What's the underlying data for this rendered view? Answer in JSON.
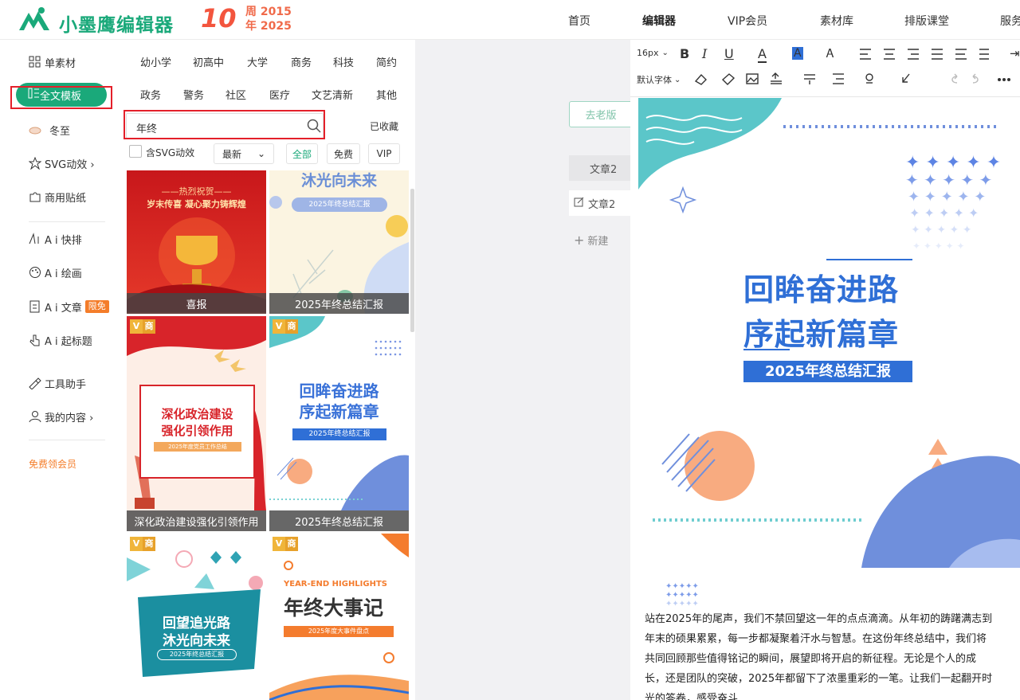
{
  "brand": {
    "name": "小墨鹰编辑器",
    "anniv_number": "10",
    "anniv_line1": "周 2015",
    "anniv_line2": "年 2025"
  },
  "nav": [
    "首页",
    "编辑器",
    "VIP会员",
    "素材库",
    "排版课堂",
    "服务"
  ],
  "sidebar": {
    "items": [
      {
        "label": "单素材",
        "icon": "grid-icon"
      },
      {
        "label": "全文模板",
        "icon": "template-icon"
      },
      {
        "label": "冬至",
        "icon": "dumpling-icon"
      },
      {
        "label": "SVG动效 ›",
        "icon": "star-icon"
      },
      {
        "label": "商用贴纸",
        "icon": "puzzle-icon"
      },
      {
        "label": "A i 快排",
        "icon": "ai-icon"
      },
      {
        "label": "A i 绘画",
        "icon": "palette-icon"
      },
      {
        "label": "A i 文章",
        "icon": "doc-icon",
        "badge": "限免"
      },
      {
        "label": "A i 起标题",
        "icon": "pointer-icon"
      },
      {
        "label": "工具助手",
        "icon": "tools-icon"
      },
      {
        "label": "我的内容 ›",
        "icon": "user-icon"
      }
    ],
    "promo": "免费领会员"
  },
  "panel": {
    "categories_row1": [
      "幼小学",
      "初高中",
      "大学",
      "商务",
      "科技",
      "简约"
    ],
    "categories_row2": [
      "政务",
      "警务",
      "社区",
      "医疗",
      "文艺清新",
      "其他"
    ],
    "search": {
      "value": "年终"
    },
    "favorites": "已收藏",
    "filters": {
      "svg": "含SVG动效",
      "sort": "最新",
      "all": "全部",
      "free": "免费",
      "vip": "VIP"
    },
    "cards": [
      {
        "caption": "喜报",
        "top": "——热烈祝贺——",
        "sub": "岁末传喜 凝心聚力铸辉煌"
      },
      {
        "caption": "2025年终总结汇报",
        "title": "沐光向未来",
        "sub": "2025年终总结汇报"
      },
      {
        "caption": "深化政治建设强化引领作用",
        "title1": "深化政治建设",
        "title2": "强化引领作用",
        "sub": "2025年度党员工作总结",
        "tag_v": "V",
        "tag_s": "商"
      },
      {
        "caption": "2025年终总结汇报",
        "title1": "回眸奋进路",
        "title2": "序起新篇章",
        "sub": "2025年终总结汇报",
        "tag_v": "V",
        "tag_s": "商"
      },
      {
        "title1": "回望追光路",
        "title2": "沐光向未来",
        "sub": "2025年终总结汇报",
        "tag_v": "V",
        "tag_s": "商"
      },
      {
        "eyebrow": "YEAR-END HIGHLIGHTS",
        "title": "年终大事记",
        "sub": "2025年度大事件盘点",
        "tag_v": "V",
        "tag_s": "商"
      }
    ]
  },
  "middle": {
    "old_version": "去老版",
    "article1": "文章2",
    "article2": "文章2",
    "new": "新建"
  },
  "toolbar": {
    "font_size": "16px",
    "font_family": "默认字体"
  },
  "document": {
    "title1": "回眸奋进路",
    "title2": "序起新篇章",
    "subtitle": "2025年终总结汇报",
    "paragraph": "站在2025年的尾声，我们不禁回望这一年的点点滴滴。从年初的踌躇满志到年末的硕果累累，每一步都凝聚着汗水与智慧。在这份年终总结中，我们将共同回顾那些值得铭记的瞬间，展望即将开启的新征程。无论是个人的成长，还是团队的突破，2025年都留下了浓墨重彩的一笔。让我们一起翻开时光的答卷，感受奋斗"
  },
  "colors": {
    "brand": "#1aa97a",
    "highlight": "#e4202a",
    "doc_blue": "#2f6fd6",
    "badge": "#f47d2a"
  }
}
